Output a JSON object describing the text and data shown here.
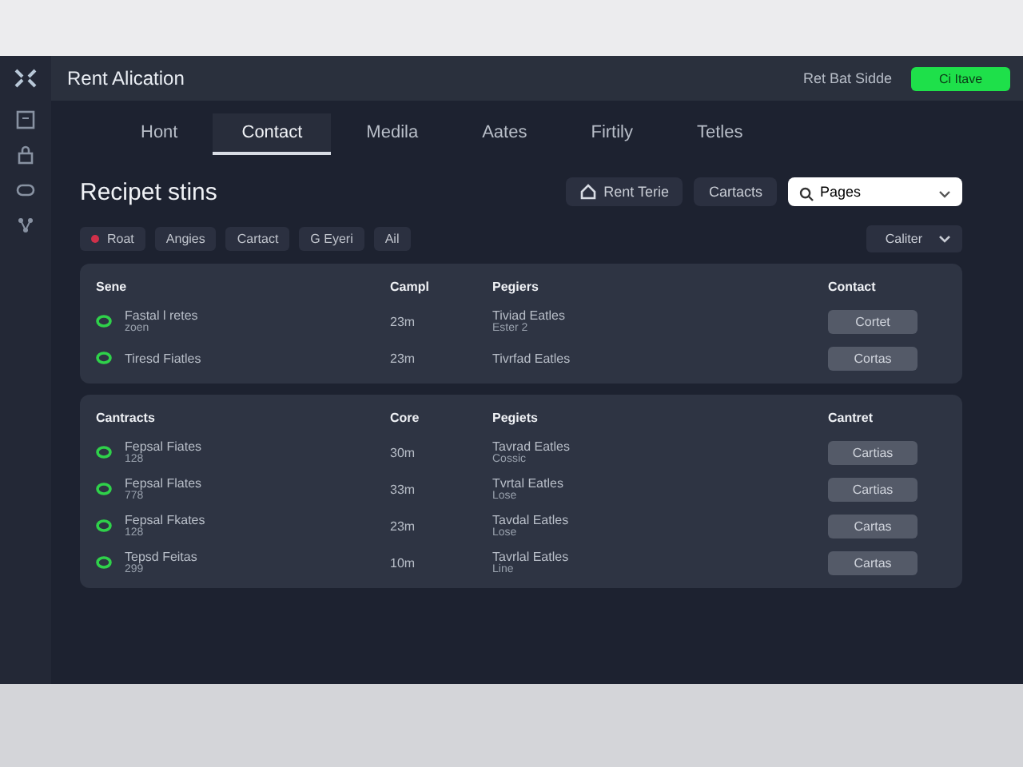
{
  "header": {
    "title": "Rent Alication",
    "link": "Ret Bat Sidde",
    "action": "Ci Itave"
  },
  "tabs": [
    {
      "label": "Hont",
      "selected": false
    },
    {
      "label": "Contact",
      "selected": true
    },
    {
      "label": "Medila",
      "selected": false
    },
    {
      "label": "Aates",
      "selected": false
    },
    {
      "label": "Firtily",
      "selected": false
    },
    {
      "label": "Tetles",
      "selected": false
    }
  ],
  "page": {
    "title": "Recipet stins",
    "buttons": [
      {
        "label": "Rent Terie",
        "kind": "icon"
      },
      {
        "label": "Cartacts",
        "kind": "plain"
      }
    ],
    "search": {
      "value": "Pages"
    }
  },
  "filters": [
    {
      "label": "Roat",
      "color": "#d0304a"
    },
    {
      "label": "Angies"
    },
    {
      "label": "Cartact"
    },
    {
      "label": "G Eyeri"
    },
    {
      "label": "Ail"
    }
  ],
  "filter_dropdown": "Caliter",
  "tables": [
    {
      "columns": [
        "Sene",
        "Campl",
        "Pegiers",
        "Contact"
      ],
      "rows": [
        {
          "name": "Fastal l retes",
          "sub": "zoen",
          "time": "23m",
          "place": "Tiviad Eatles",
          "place_sub": "Ester 2",
          "action": "Cortet"
        },
        {
          "name": "Tiresd Fiatles",
          "time": "23m",
          "place": "Tivrfad Eatles",
          "action": "Cortas"
        }
      ]
    },
    {
      "columns": [
        "Cantracts",
        "Core",
        "Pegiets",
        "Cantret"
      ],
      "rows": [
        {
          "name": "Fepsal Fiates",
          "sub": "128",
          "time": "30m",
          "place": "Tavrad Eatles",
          "place_sub": "Cossic",
          "action": "Cartias"
        },
        {
          "name": "Fepsal Flates",
          "sub": "778",
          "time": "33m",
          "place": "Tvrtal Eatles",
          "place_sub": "Lose",
          "action": "Cartias"
        },
        {
          "name": "Fepsal Fkates",
          "sub": "128",
          "time": "23m",
          "place": "Tavdal Eatles",
          "place_sub": "Lose",
          "action": "Cartas"
        },
        {
          "name": "Tepsd Feitas",
          "sub": "299",
          "time": "10m",
          "place": "Tavrlal Eatles",
          "place_sub": "Line",
          "action": "Cartas"
        }
      ]
    }
  ]
}
